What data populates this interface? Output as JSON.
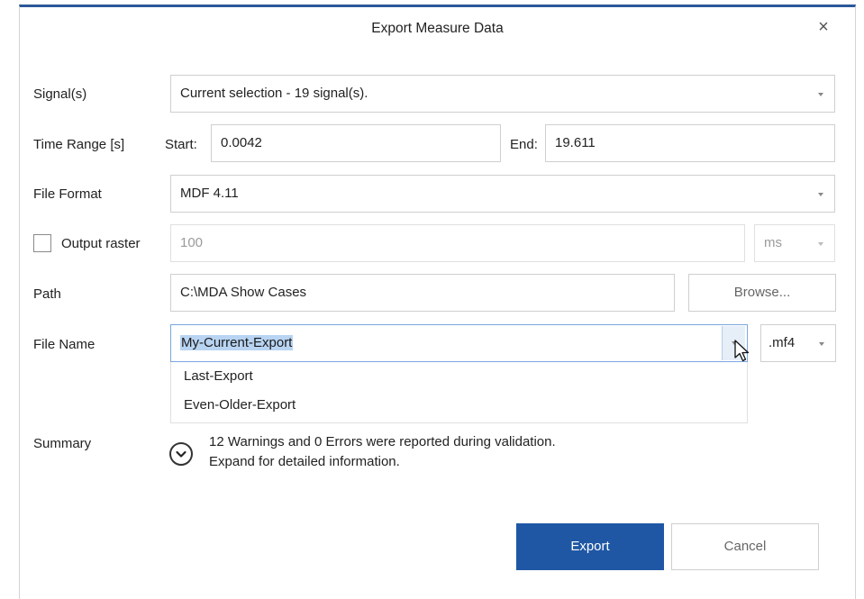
{
  "dialog": {
    "title": "Export Measure Data",
    "close_glyph": "×"
  },
  "signals": {
    "label": "Signal(s)",
    "value": "Current selection - 19 signal(s)."
  },
  "time_range": {
    "label": "Time Range [s]",
    "start_label": "Start:",
    "start_value": "0.0042",
    "end_label": "End:",
    "end_value": "19.611"
  },
  "file_format": {
    "label": "File Format",
    "value": "MDF 4.11"
  },
  "output_raster": {
    "label": "Output raster",
    "checked": false,
    "value": "100",
    "unit": "ms"
  },
  "path": {
    "label": "Path",
    "value": "C:\\MDA Show Cases",
    "browse_label": "Browse..."
  },
  "file_name": {
    "label": "File Name",
    "value": "My-Current-Export",
    "extension": ".mf4",
    "dropdown_items": [
      "Last-Export",
      "Even-Older-Export"
    ]
  },
  "summary": {
    "label": "Summary",
    "line1": "12 Warnings and 0 Errors were reported during validation.",
    "line2": "Expand for detailed information."
  },
  "buttons": {
    "export_label": "Export",
    "cancel_label": "Cancel"
  },
  "colors": {
    "accent": "#1f57a5",
    "selection": "#b8d4f2",
    "title_bar_border": "#2b579a"
  },
  "icons": {
    "expand": "chevron-down-circle-icon",
    "cursor": "mouse-pointer-icon"
  }
}
